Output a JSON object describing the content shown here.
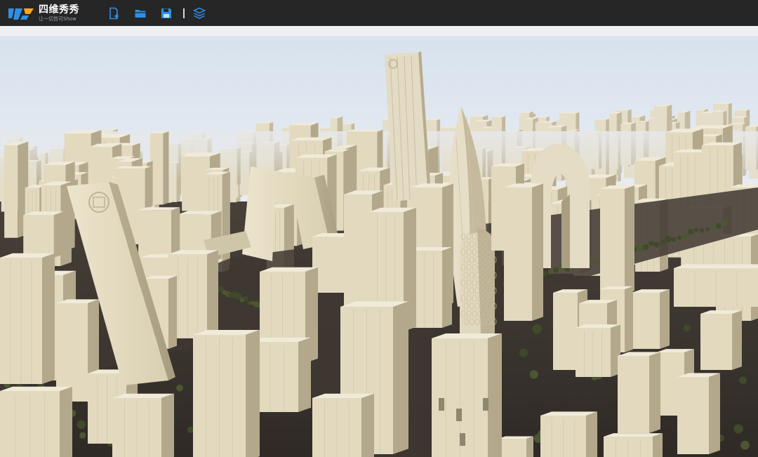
{
  "app": {
    "name": "四维秀秀",
    "slogan": "让一切皆可Show"
  },
  "toolbar": {
    "tools": [
      {
        "icon": "new-file-icon"
      },
      {
        "icon": "open-folder-icon"
      },
      {
        "icon": "save-icon"
      },
      {
        "icon": "layers-icon"
      }
    ]
  },
  "colors": {
    "toolbar_bg": "#262626",
    "accent": "#2f8fe6",
    "sky_top": "#dde6f1",
    "building": "#ddd3b8",
    "ground": "#3b3530"
  }
}
